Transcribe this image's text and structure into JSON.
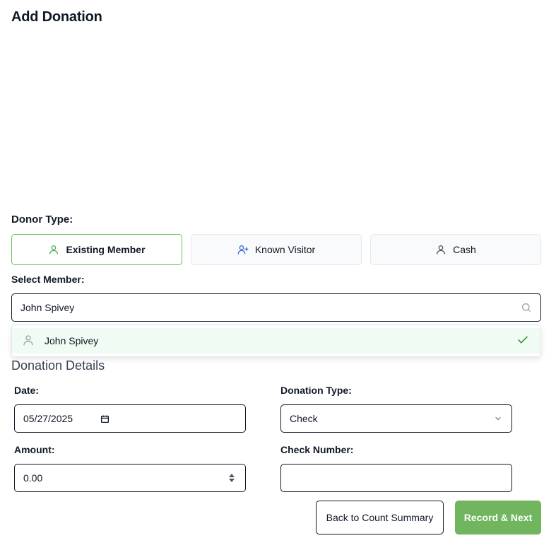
{
  "page": {
    "title": "Add Donation"
  },
  "donor_type": {
    "label": "Donor Type:",
    "options": [
      {
        "label": "Existing Member",
        "icon": "user-icon",
        "selected": true
      },
      {
        "label": "Known Visitor",
        "icon": "user-plus-icon",
        "selected": false
      },
      {
        "label": "Cash",
        "icon": "user-icon",
        "selected": false
      }
    ]
  },
  "member": {
    "label": "Select Member:",
    "search_value": "John Spivey",
    "results": [
      {
        "name": "John Spivey",
        "selected": true
      }
    ]
  },
  "details": {
    "title": "Donation Details",
    "date_label": "Date:",
    "date_value": "05/27/2025",
    "type_label": "Donation Type:",
    "type_value": "Check",
    "amount_label": "Amount:",
    "amount_value": "0.00",
    "check_label": "Check Number:",
    "check_value": ""
  },
  "actions": {
    "back_label": "Back to Count Summary",
    "record_label": "Record & Next"
  },
  "colors": {
    "accent": "#71b65f",
    "selected_bg": "#f0fbf3",
    "blue_icon": "#3b6fd4"
  }
}
